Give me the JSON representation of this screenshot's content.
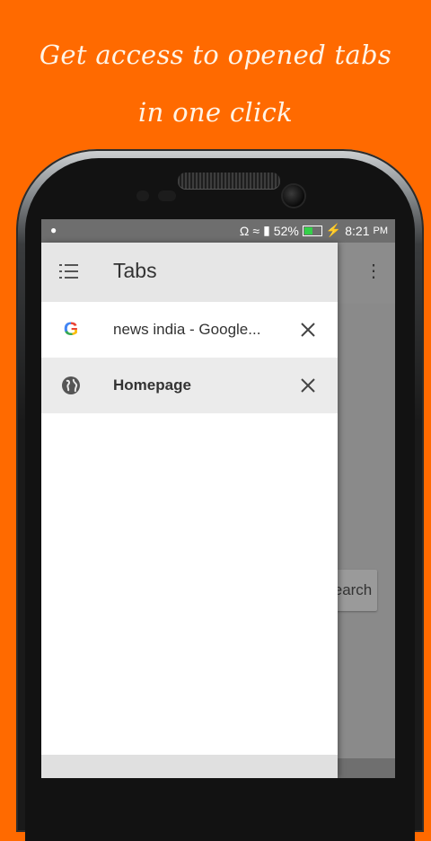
{
  "promo": {
    "line1": "Get access to opened tabs",
    "line2": "in one click"
  },
  "status_bar": {
    "battery_percent": "52%",
    "battery_level": 0.52,
    "time": "8:21",
    "ampm": "PM"
  },
  "drawer": {
    "title": "Tabs",
    "tabs": [
      {
        "title": "news india - Google...",
        "icon": "google-icon",
        "active": false
      },
      {
        "title": "Homepage",
        "icon": "globe-icon",
        "active": true
      }
    ]
  },
  "background_page": {
    "search_button_label": "earch"
  },
  "colors": {
    "promo_background": "#ff6a00",
    "drawer_header": "#e6e6e6",
    "active_tab_background": "#ebebeb",
    "battery_fill": "#35d04a"
  }
}
